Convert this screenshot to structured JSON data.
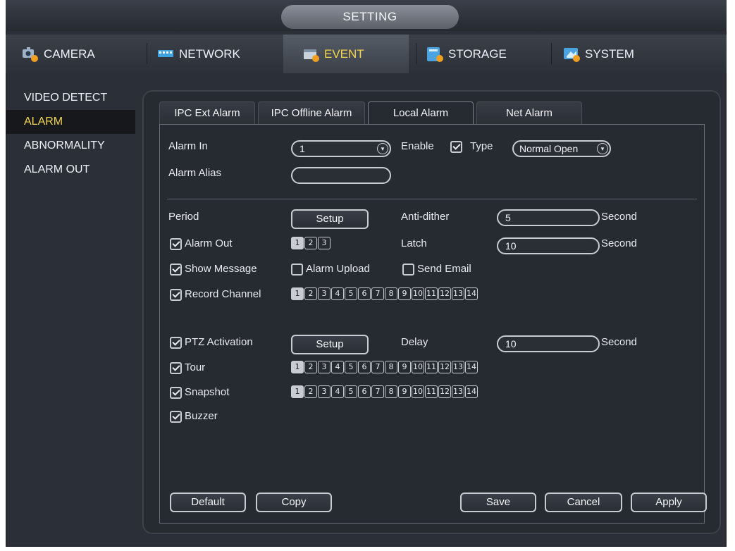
{
  "window": {
    "title": "SETTING"
  },
  "main_tabs": [
    {
      "label": "CAMERA",
      "icon": "camera-icon"
    },
    {
      "label": "NETWORK",
      "icon": "network-icon"
    },
    {
      "label": "EVENT",
      "icon": "event-icon",
      "active": true
    },
    {
      "label": "STORAGE",
      "icon": "storage-icon"
    },
    {
      "label": "SYSTEM",
      "icon": "system-icon"
    }
  ],
  "sidebar": {
    "items": [
      {
        "label": "VIDEO DETECT"
      },
      {
        "label": "ALARM",
        "active": true
      },
      {
        "label": "ABNORMALITY"
      },
      {
        "label": "ALARM OUT"
      }
    ]
  },
  "sub_tabs": [
    {
      "label": "IPC Ext Alarm"
    },
    {
      "label": "IPC Offline Alarm"
    },
    {
      "label": "Local Alarm",
      "active": true
    },
    {
      "label": "Net Alarm"
    }
  ],
  "form": {
    "alarm_in_label": "Alarm In",
    "alarm_in_value": "1",
    "enable_label": "Enable",
    "enable_checked": true,
    "type_label": "Type",
    "type_value": "Normal Open",
    "alarm_alias_label": "Alarm Alias",
    "alarm_alias_value": "",
    "period_label": "Period",
    "setup_label": "Setup",
    "anti_dither_label": "Anti-dither",
    "anti_dither_value": "5",
    "second_label": "Second",
    "alarm_out_label": "Alarm Out",
    "alarm_out_checked": true,
    "alarm_out_channels": [
      "1",
      "2",
      "3"
    ],
    "alarm_out_selected": [
      "1"
    ],
    "latch_label": "Latch",
    "latch_value": "10",
    "show_message_label": "Show Message",
    "show_message_checked": true,
    "alarm_upload_label": "Alarm Upload",
    "alarm_upload_checked": false,
    "send_email_label": "Send Email",
    "send_email_checked": false,
    "record_channel_label": "Record Channel",
    "record_channel_checked": true,
    "channels": [
      "1",
      "2",
      "3",
      "4",
      "5",
      "6",
      "7",
      "8",
      "9",
      "10",
      "11",
      "12",
      "13",
      "14"
    ],
    "record_channel_selected": [
      "1"
    ],
    "ptz_activation_label": "PTZ Activation",
    "ptz_activation_checked": true,
    "delay_label": "Delay",
    "delay_value": "10",
    "tour_label": "Tour",
    "tour_checked": true,
    "tour_selected": [
      "1"
    ],
    "snapshot_label": "Snapshot",
    "snapshot_checked": true,
    "snapshot_selected": [
      "1"
    ],
    "buzzer_label": "Buzzer",
    "buzzer_checked": true
  },
  "footer": {
    "default_label": "Default",
    "copy_label": "Copy",
    "save_label": "Save",
    "cancel_label": "Cancel",
    "apply_label": "Apply"
  },
  "colors": {
    "active_accent": "#f3d54e",
    "background": "#2b2f37",
    "panel": "#262a31"
  }
}
